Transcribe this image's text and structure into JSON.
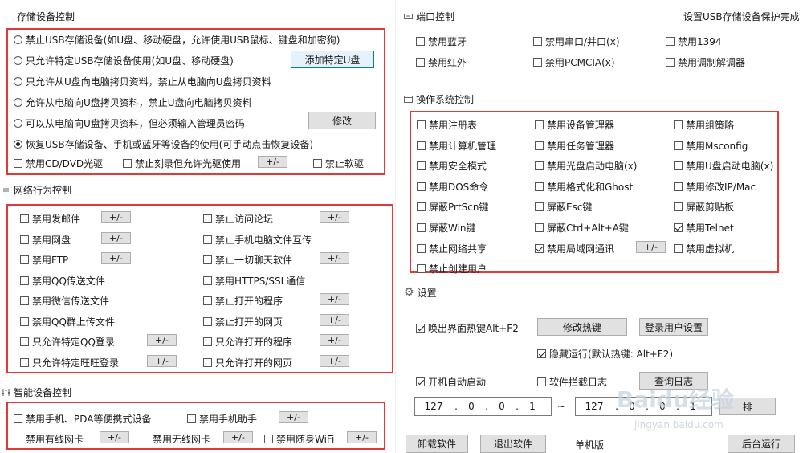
{
  "storage": {
    "title": "存储设备控制",
    "options": [
      "禁止USB存储设备(如U盘、移动硬盘，允许使用USB鼠标、键盘和加密狗)",
      "只允许特定USB存储设备使用(如U盘、移动硬盘)",
      "只允许从U盘向电脑拷贝资料，禁止从电脑向U盘拷贝资料",
      "允许从电脑向U盘拷贝资料，禁止U盘向电脑拷贝资料",
      "可以从电脑向U盘拷贝资料，但必须输入管理员密码",
      "恢复USB存储设备、手机或蓝牙等设备的使用(可手动点击恢复设备)"
    ],
    "selected_index": 5,
    "add_specific_button": "添加特定U盘",
    "modify_button": "修改",
    "cd_dvd": "禁用CD/DVD光驱",
    "burn": "禁止刻录但允许光驱使用",
    "floppy": "禁止软驱",
    "plus_minus": "+/-"
  },
  "network": {
    "title": "网络行为控制",
    "left": [
      {
        "label": "禁用发邮件",
        "has_btn": true
      },
      {
        "label": "禁用网盘",
        "has_btn": true
      },
      {
        "label": "禁用FTP",
        "has_btn": true
      },
      {
        "label": "禁用QQ传送文件",
        "has_btn": false
      },
      {
        "label": "禁用微信传送文件",
        "has_btn": false
      },
      {
        "label": "禁用QQ群上传文件",
        "has_btn": false
      },
      {
        "label": "只允许特定QQ登录",
        "has_btn": true
      },
      {
        "label": "只允许特定旺旺登录",
        "has_btn": true
      }
    ],
    "right": [
      {
        "label": "禁止访问论坛",
        "has_btn": true
      },
      {
        "label": "禁止手机电脑文件互传",
        "has_btn": false
      },
      {
        "label": "禁止一切聊天软件",
        "has_btn": true
      },
      {
        "label": "禁用HTTPS/SSL通信",
        "has_btn": false
      },
      {
        "label": "禁止打开的程序",
        "has_btn": true
      },
      {
        "label": "禁止打开的网页",
        "has_btn": true
      },
      {
        "label": "只允许打开的程序",
        "has_btn": true
      },
      {
        "label": "只允许打开的网页",
        "has_btn": true
      }
    ],
    "plus_minus": "+/-"
  },
  "smart": {
    "title": "智能设备控制",
    "mobile": "禁用手机、PDA等便携式设备",
    "assistant": "禁用手机助手",
    "wired": "禁用有线网卡",
    "wireless": "禁用无线网卡",
    "wifi": "禁用随身WiFi",
    "plus_minus": "+/-"
  },
  "port": {
    "title": "端口控制",
    "status": "设置USB存储设备保护完成",
    "items": [
      "禁用蓝牙",
      "禁用串口/并口(x)",
      "禁用1394",
      "禁用红外",
      "禁用PCMCIA(x)",
      "禁用调制解调器"
    ]
  },
  "os": {
    "title": "操作系统控制",
    "col1": [
      "禁用注册表",
      "禁用计算机管理",
      "禁用安全模式",
      "禁用DOS命令",
      "屏蔽PrtScn键",
      "屏蔽Win键",
      "禁止网络共享",
      "禁止创建用户"
    ],
    "col2": [
      "禁用设备管理器",
      "禁用任务管理器",
      "禁用光盘启动电脑(x)",
      "禁用格式化和Ghost",
      "屏蔽Esc键",
      "屏蔽Ctrl+Alt+A键",
      "禁用局域网通讯"
    ],
    "col3": [
      "禁用组策略",
      "禁用Msconfig",
      "禁用U盘启动电脑(x)",
      "禁用修改IP/Mac",
      "屏蔽剪贴板",
      "禁用Telnet",
      "禁用虚拟机"
    ],
    "checked": {
      "col2": [
        6
      ],
      "col3": [
        5
      ]
    },
    "plus_minus": "+/-"
  },
  "settings": {
    "title": "设置",
    "hotkey_label": "唤出界面热键Alt+F2",
    "modify_hotkey": "修改热键",
    "login_settings": "登录用户设置",
    "hide_run": "隐藏运行(默认热键: Alt+F2)",
    "autostart": "开机自动启动",
    "intercept_log": "软件拦截日志",
    "query_log": "查询日志",
    "ip1": [
      "127",
      "0",
      "0",
      "1"
    ],
    "ip2": [
      "127",
      "0",
      "0",
      "1"
    ],
    "tilde": "~",
    "exclude": "排"
  },
  "bottom": {
    "uninstall": "卸载软件",
    "exit": "退出软件",
    "mode": "单机版",
    "background": "后台运行"
  },
  "watermark": {
    "brand": "Baidu经验",
    "url": "jingyan.baidu.com"
  }
}
